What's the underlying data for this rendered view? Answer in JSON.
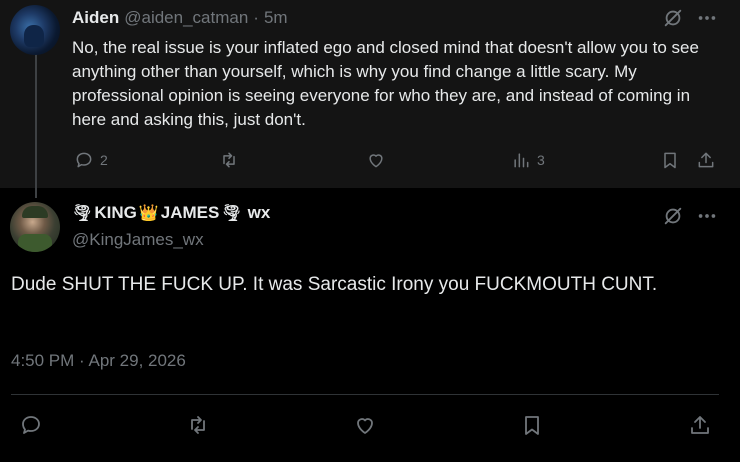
{
  "reply": {
    "name": "Aiden",
    "handle": "@aiden_catman",
    "separator": "·",
    "time": "5m",
    "text": "No, the real issue is your inflated ego and closed mind that doesn't allow you to see anything other than yourself, which is why you find change a little scary. My professional opinion is seeing everyone for who they are, and instead of coming in here and asking this, just don't.",
    "reply_count": "2",
    "view_count": "3",
    "icons": {
      "grok": "grok-icon",
      "more": "more-icon",
      "reply": "reply-icon",
      "retweet": "retweet-icon",
      "like": "like-icon",
      "views": "views-icon",
      "bookmark": "bookmark-icon",
      "share": "share-icon"
    }
  },
  "main": {
    "name_part1": "KING",
    "name_part2": "JAMES",
    "name_part3": "wx",
    "emoji_tornado": "🌪",
    "emoji_crown": "👑",
    "handle": "@KingJames_wx",
    "text": "Dude SHUT THE FUCK UP. It was Sarcastic Irony you FUCKMOUTH CUNT.",
    "timestamp": "4:50 PM · Apr 29, 2026"
  },
  "colors": {
    "background": "#000000",
    "reply_background": "#141414",
    "text": "#e7e9ea",
    "muted": "#71767b",
    "divider": "#2f3336"
  }
}
